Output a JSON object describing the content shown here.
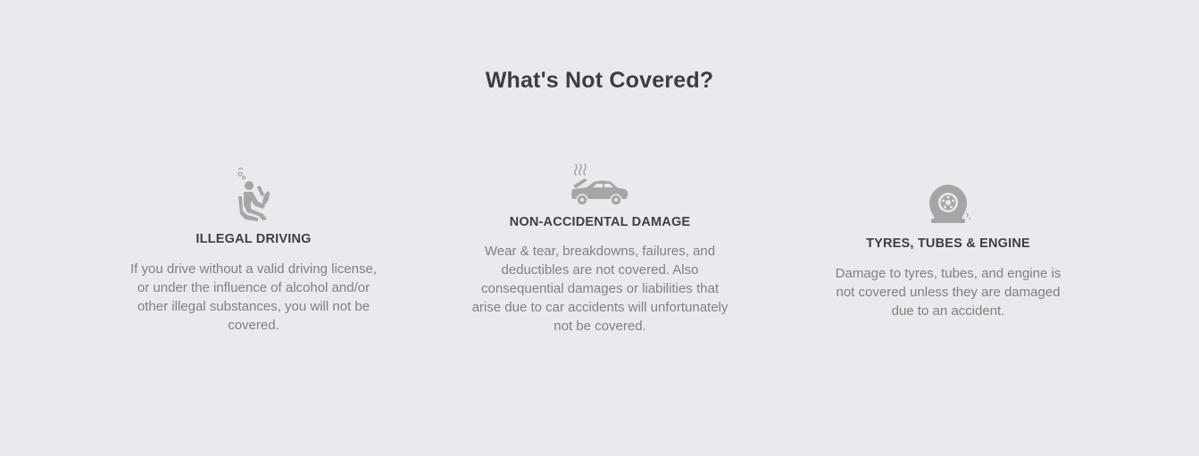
{
  "section": {
    "title": "What's Not Covered?"
  },
  "colors": {
    "background": "#e9eaee",
    "icon": "#a6a6a6",
    "heading": "#3f3f3f",
    "text": "#808080"
  },
  "items": [
    {
      "icon": "drunk-driver-icon",
      "heading": "ILLEGAL DRIVING",
      "description": "If you drive without a valid driving license, or under the influence of alcohol and/or other illegal substances, you will not be covered."
    },
    {
      "icon": "broken-car-icon",
      "heading": "NON-ACCIDENTAL DAMAGE",
      "description": "Wear & tear, breakdowns, failures, and deductibles are not covered. Also consequential damages or liabilities that arise due to car accidents will unfortunately not be covered."
    },
    {
      "icon": "flat-tyre-icon",
      "heading": "TYRES, TUBES & ENGINE",
      "description": "Damage to tyres, tubes, and engine is not covered unless they are damaged due to an accident."
    }
  ]
}
